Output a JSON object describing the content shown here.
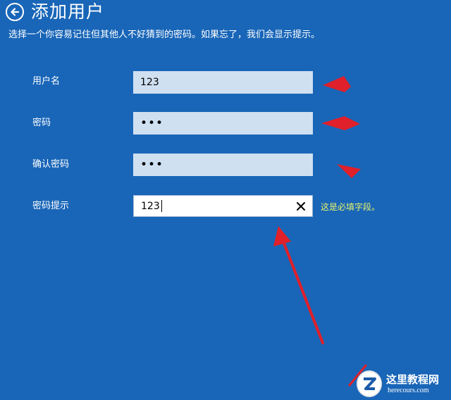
{
  "header": {
    "title": "添加用户",
    "subtitle": "选择一个你容易记住但其他人不好猜到的密码。如果忘了，我们会显示提示。"
  },
  "form": {
    "username": {
      "label": "用户名",
      "value": "123"
    },
    "password": {
      "label": "密码",
      "value": "•••"
    },
    "confirm_password": {
      "label": "确认密码",
      "value": "•••"
    },
    "password_hint": {
      "label": "密码提示",
      "value": "123",
      "validation": "这是必填字段。"
    }
  },
  "watermark": {
    "name": "这里教程网",
    "url": "herecours.com"
  },
  "colors": {
    "background": "#1966b8",
    "field_bg": "#cfe0f1",
    "validation_text": "#e6f26a",
    "annotation_arrow": "#e0202a"
  }
}
